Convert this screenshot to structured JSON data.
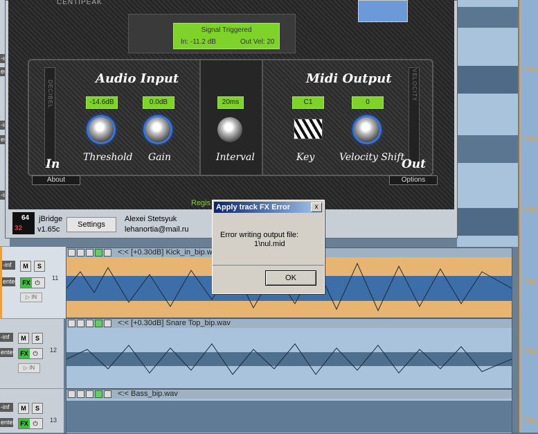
{
  "dialog": {
    "title": "Apply track FX Error",
    "close": "x",
    "message_line1": "Error writing output file:",
    "message_line2": "1\\nul.mid",
    "ok": "OK"
  },
  "plugin": {
    "brand": "CENTIPEAK",
    "signal_title": "Signal Triggered",
    "signal_in": "In: -11.2 dB",
    "signal_out": "Out Vel: 20",
    "audio_input_title": "Audio Input",
    "midi_output_title": "Midi Output",
    "decibel_label": "DECIBEL",
    "velocity_label": "VELOCITY",
    "threshold_value": "-14.6dB",
    "gain_value": "0.0dB",
    "interval_value": "20ms",
    "key_value": "C1",
    "velshift_value": "0",
    "threshold_label": "Threshold",
    "gain_label": "Gain",
    "interval_label": "Interval",
    "key_label": "Key",
    "velshift_label": "Velocity Shift",
    "in_label": "In",
    "out_label": "Out",
    "about": "About",
    "options": "Options",
    "regis_text": "Regis"
  },
  "jbridge": {
    "logo_top": "64",
    "logo_bottom": "32",
    "name": "jBridge",
    "version": "v1.65c",
    "settings": "Settings",
    "author": "Alexei Stetsyuk",
    "email": "lehanortia@mail.ru"
  },
  "tracks": [
    {
      "num": "11",
      "name": "<:< [+0.30dB] Kick_in_bip.wav",
      "vol": "-inf",
      "pan": "enter"
    },
    {
      "num": "12",
      "name": "<:< [+0.30dB] Snare Top_bip.wav",
      "vol": "-inf",
      "pan": "enter"
    },
    {
      "num": "13",
      "name": "<:< Bass_bip.wav",
      "vol": "-inf",
      "pan": "enter"
    }
  ],
  "track_labels": {
    "m": "M",
    "s": "S",
    "fx": "FX",
    "in": "IN"
  },
  "right_marker": "Mar"
}
